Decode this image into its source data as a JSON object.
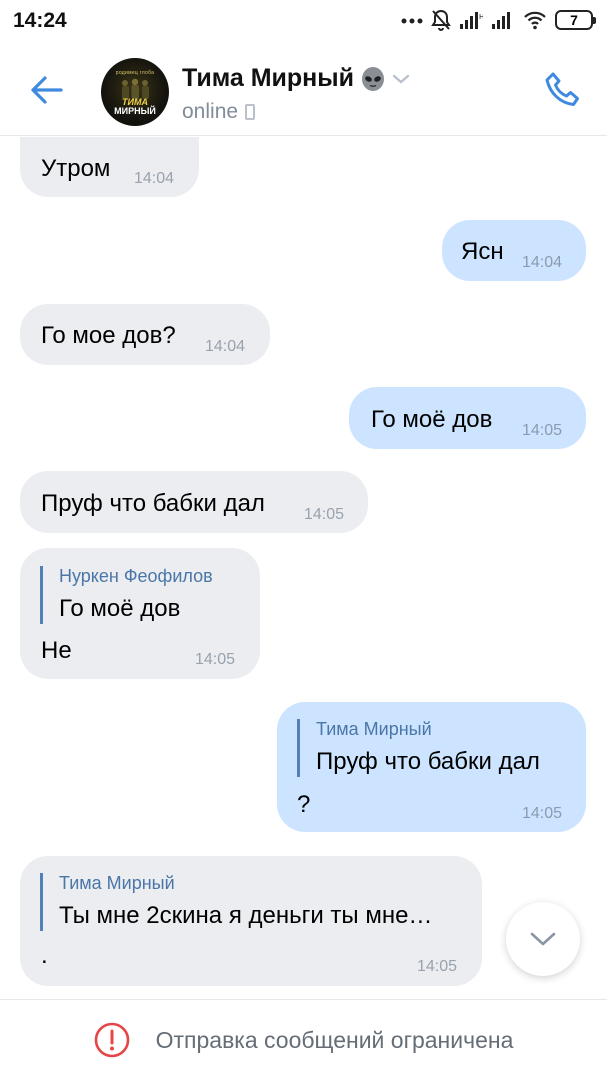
{
  "status_bar": {
    "time": "14:24",
    "battery": "7",
    "icons": [
      "dots-icon",
      "bell-muted-icon",
      "signal-icon",
      "signal-icon",
      "wifi-icon",
      "battery-icon"
    ]
  },
  "header": {
    "contact_name": "Тима Мирный",
    "status": "online",
    "avatar_caption_top": "родимец глоба",
    "avatar_logo_line1": "ТИМА",
    "avatar_logo_line2": "МИРНЫЙ",
    "name_emoji": "alien-icon",
    "accent_color": "#3f8ae0"
  },
  "messages": [
    {
      "dir": "in",
      "text": "Утром",
      "time": "14:04"
    },
    {
      "dir": "out",
      "text": "Ясн",
      "time": "14:04"
    },
    {
      "dir": "in",
      "text": "Го мое дов?",
      "time": "14:04"
    },
    {
      "dir": "out",
      "text": "Го моё дов",
      "time": "14:05"
    },
    {
      "dir": "in",
      "text": "Пруф что бабки дал",
      "time": "14:05"
    },
    {
      "dir": "in",
      "reply_author": "Нуркен Феофилов",
      "reply_text": "Го моё дов",
      "text": "Не",
      "time": "14:05"
    },
    {
      "dir": "out",
      "reply_author": "Тима Мирный",
      "reply_text": "Пруф что бабки дал",
      "text": "?",
      "time": "14:05"
    },
    {
      "dir": "in",
      "reply_author": "Тима Мирный",
      "reply_text": "Ты мне 2скина я деньги ты мне…",
      "text": ".",
      "time": "14:05"
    }
  ],
  "footer": {
    "notice": "Отправка сообщений ограничена",
    "notice_color": "#e64646"
  }
}
